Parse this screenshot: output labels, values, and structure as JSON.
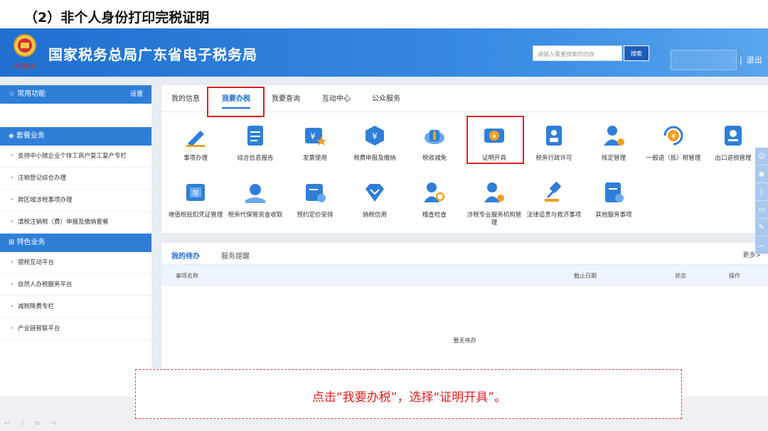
{
  "slide_title": "（2）非个人身份打印完税证明",
  "header": {
    "site_title": "国家税务总局广东省电子税务局",
    "logo_text": "中国税务",
    "search_placeholder": "请输入需要搜索的内容",
    "search_button": "搜索",
    "logout_sep": "|",
    "logout": "退出"
  },
  "sidebar": {
    "common": {
      "label": "常用功能",
      "settings": "设置"
    },
    "package": {
      "label": "套餐业务",
      "items": [
        "支持中小微企业个体工商户复工复产专栏",
        "注销登记综合办理",
        "跨区域涉税事项办理",
        "清税注销税（费）申报及缴纳套餐"
      ]
    },
    "special": {
      "label": "特色业务",
      "items": [
        "银税互动平台",
        "自然人办税服务平台",
        "减税降费专栏",
        "产业链智联平台"
      ]
    }
  },
  "tabs": [
    "我的信息",
    "我要办税",
    "我要查询",
    "互动中心",
    "公众服务"
  ],
  "services_row1": [
    {
      "label": "事项办理",
      "icon": "pen-icon"
    },
    {
      "label": "综合信息报告",
      "icon": "report-icon"
    },
    {
      "label": "发票使用",
      "icon": "invoice-icon"
    },
    {
      "label": "税费申报及缴纳",
      "icon": "declare-icon"
    },
    {
      "label": "税收减免",
      "icon": "coins-icon"
    },
    {
      "label": "证明开具",
      "icon": "certificate-icon"
    },
    {
      "label": "税务行政许可",
      "icon": "license-icon"
    },
    {
      "label": "核定管理",
      "icon": "user-gear-icon"
    },
    {
      "label": "一般退（抵）税管理",
      "icon": "refund-icon"
    },
    {
      "label": "出口退税管理",
      "icon": "export-icon"
    }
  ],
  "services_row2": [
    {
      "label": "增值税抵扣凭证管理",
      "icon": "vat-icon"
    },
    {
      "label": "税务代保管资金收取",
      "icon": "money-bag-icon"
    },
    {
      "label": "预约定价安排",
      "icon": "calendar-icon"
    },
    {
      "label": "纳税信用",
      "icon": "diamond-icon"
    },
    {
      "label": "稽查检查",
      "icon": "inspect-icon"
    },
    {
      "label": "涉税专业服务机构管理",
      "icon": "agency-icon"
    },
    {
      "label": "法律追责与救济事项",
      "icon": "gavel-icon"
    },
    {
      "label": "其他服务事项",
      "icon": "other-icon"
    }
  ],
  "todo": {
    "tab_active": "我的待办",
    "tab_other": "服务提醒",
    "more": "更多>",
    "col_name": "事项名称",
    "col_deadline": "截止日期",
    "col_status": "状态",
    "col_action": "操作",
    "empty": "暂无待办"
  },
  "note": "点击“我要办税”，选择“证明开具”。",
  "colors": {
    "primary": "#1f6fcf",
    "highlight": "#e02020"
  }
}
